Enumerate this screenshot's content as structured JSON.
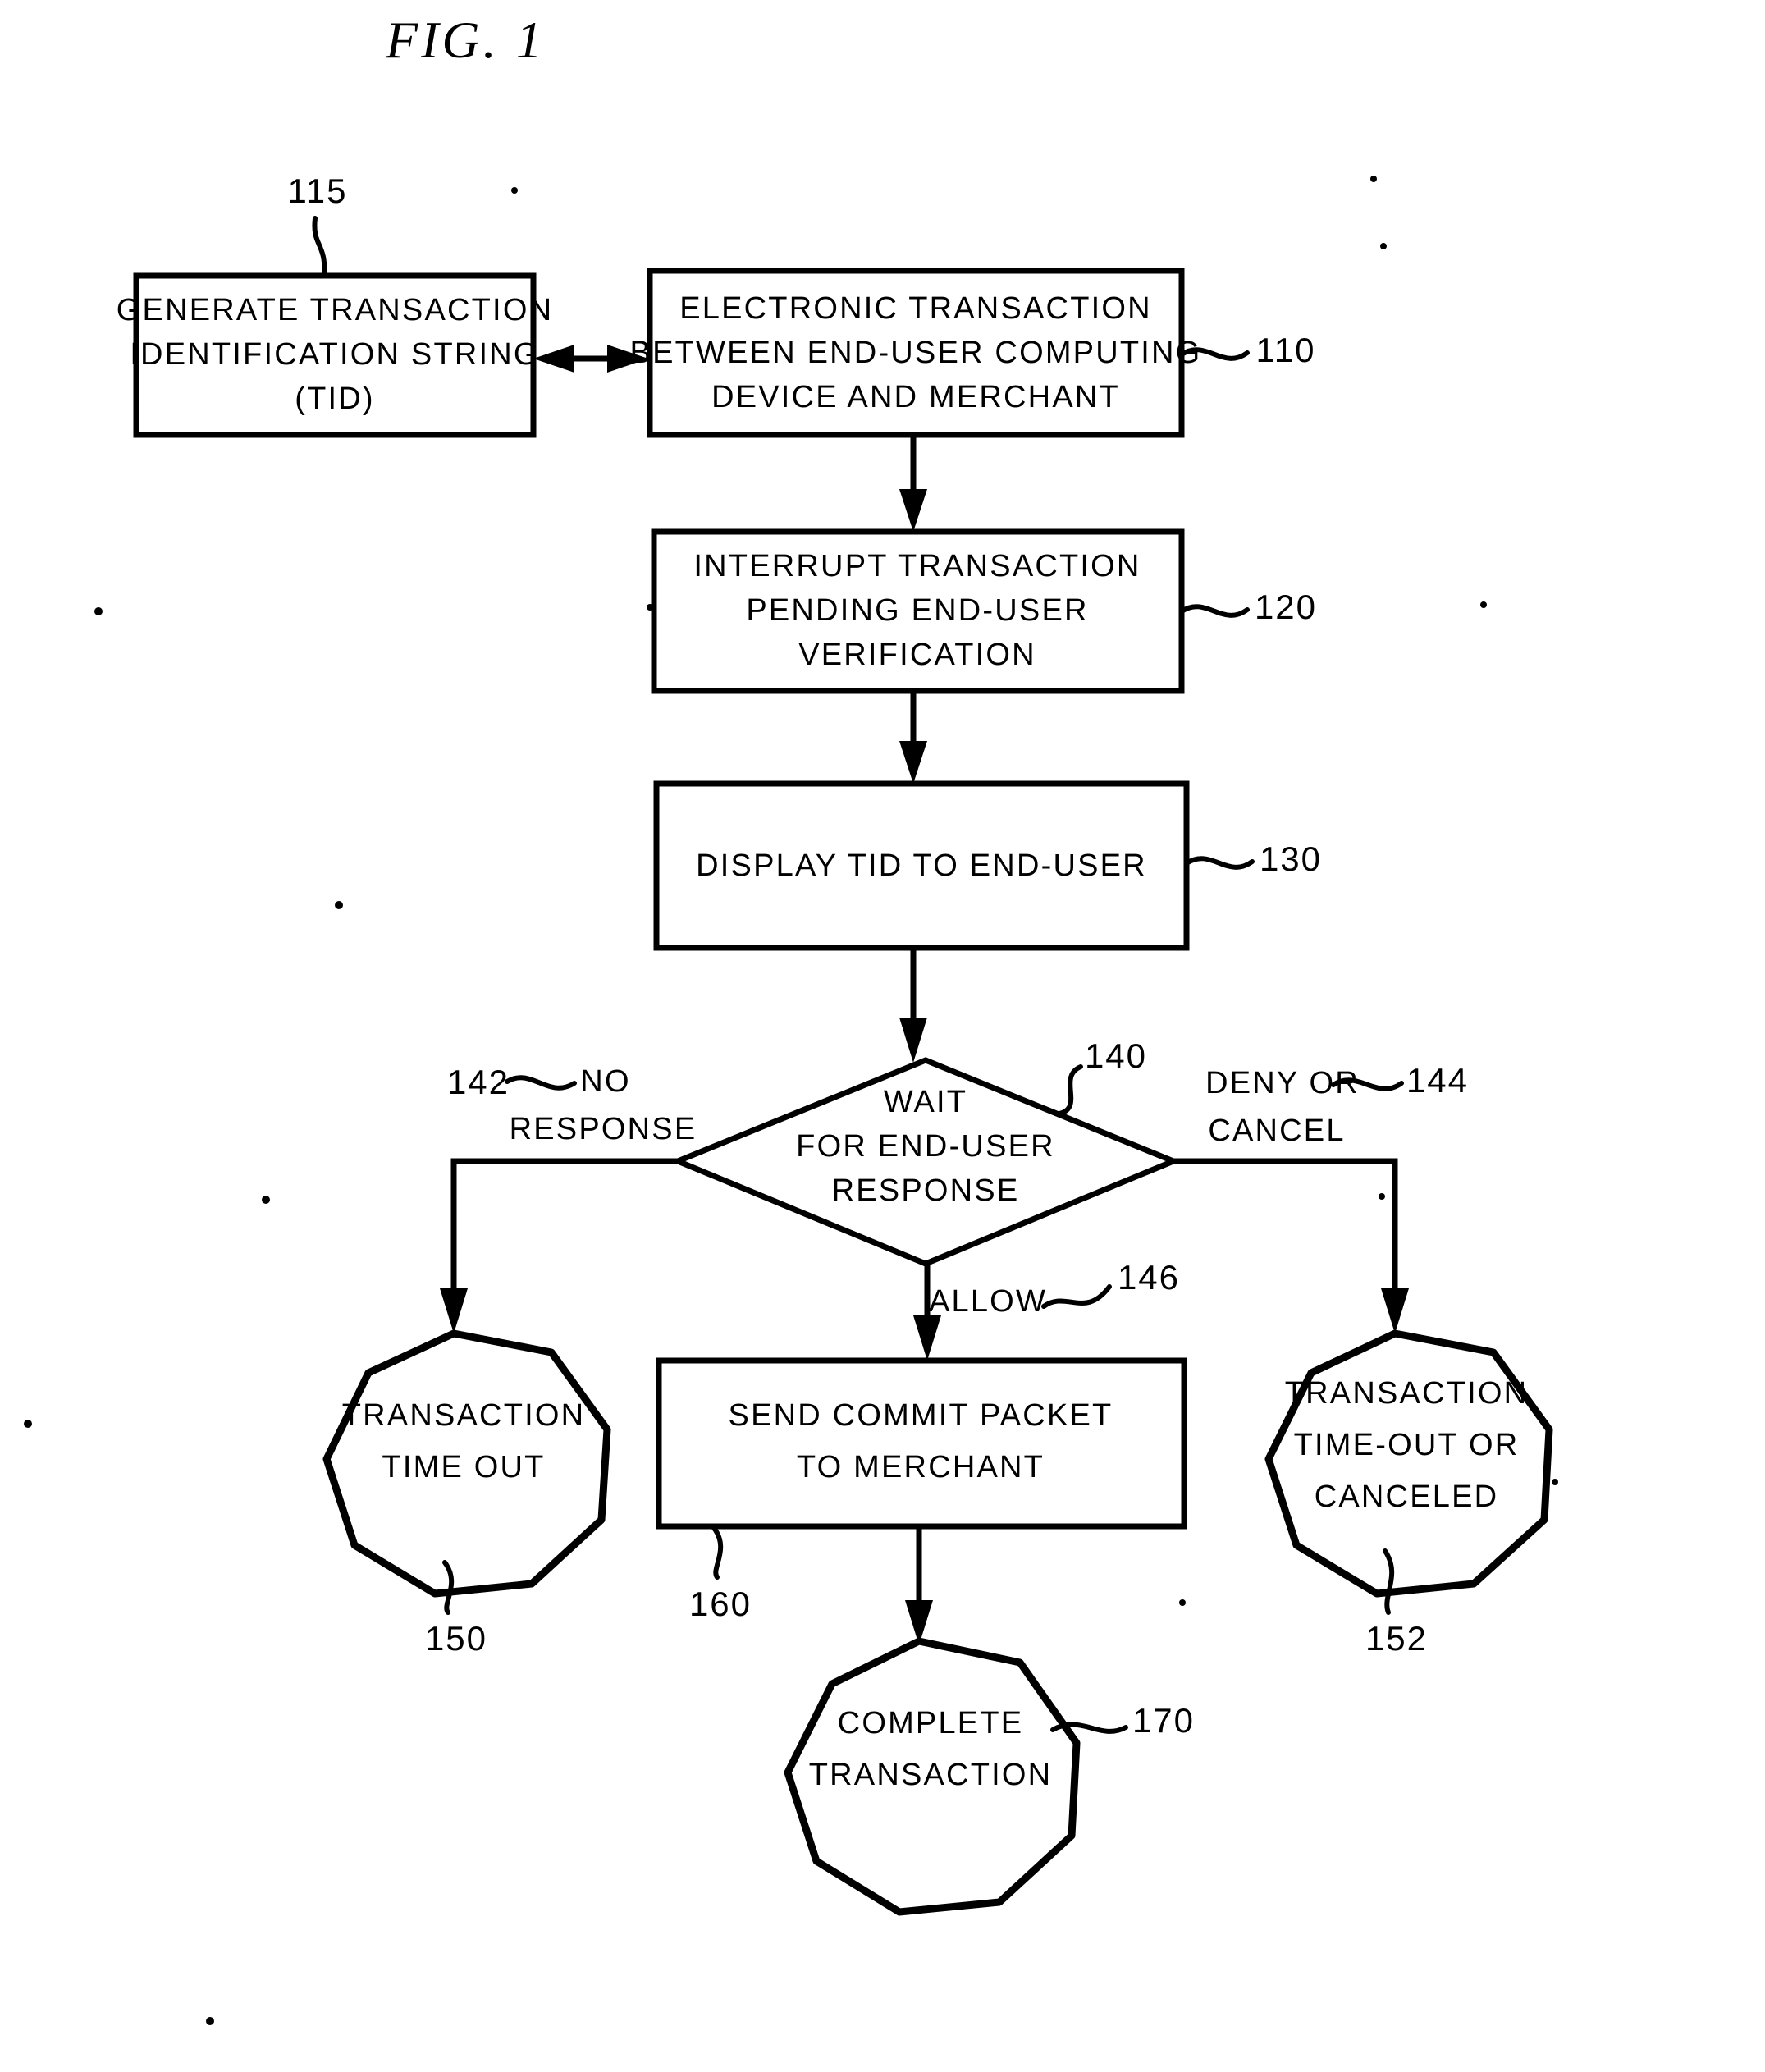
{
  "figure": {
    "title": "FIG. 1",
    "type": "patent-flowchart"
  },
  "nodes": {
    "n115": {
      "ref": "115",
      "shape": "rectangle",
      "lines": [
        "GENERATE TRANSACTION",
        "IDENTIFICATION STRING",
        "(TID)"
      ]
    },
    "n110": {
      "ref": "110",
      "shape": "rectangle",
      "lines": [
        "ELECTRONIC TRANSACTION",
        "BETWEEN END-USER COMPUTING",
        "DEVICE AND MERCHANT"
      ]
    },
    "n120": {
      "ref": "120",
      "shape": "rectangle",
      "lines": [
        "INTERRUPT TRANSACTION",
        "PENDING END-USER",
        "VERIFICATION"
      ]
    },
    "n130": {
      "ref": "130",
      "shape": "rectangle",
      "lines": [
        "DISPLAY TID TO END-USER"
      ]
    },
    "n140": {
      "ref": "140",
      "shape": "diamond",
      "lines": [
        "WAIT",
        "FOR END-USER",
        "RESPONSE"
      ]
    },
    "n150": {
      "ref": "150",
      "shape": "nonagon",
      "lines": [
        "TRANSACTION",
        "TIME OUT"
      ]
    },
    "n160": {
      "ref": "160",
      "shape": "rectangle",
      "lines": [
        "SEND COMMIT PACKET",
        "TO MERCHANT"
      ]
    },
    "n152": {
      "ref": "152",
      "shape": "nonagon",
      "lines": [
        "TRANSACTION",
        "TIME-OUT OR",
        "CANCELED"
      ]
    },
    "n170": {
      "ref": "170",
      "shape": "nonagon",
      "lines": [
        "COMPLETE",
        "TRANSACTION"
      ]
    }
  },
  "edges": {
    "e142": {
      "ref": "142",
      "lines": [
        "NO",
        "RESPONSE"
      ]
    },
    "e144": {
      "ref": "144",
      "lines": [
        "DENY OR",
        "CANCEL"
      ]
    },
    "e146": {
      "ref": "146",
      "lines": [
        "ALLOW"
      ]
    }
  },
  "colors": {
    "ink": "#000000",
    "paper": "#ffffff"
  }
}
